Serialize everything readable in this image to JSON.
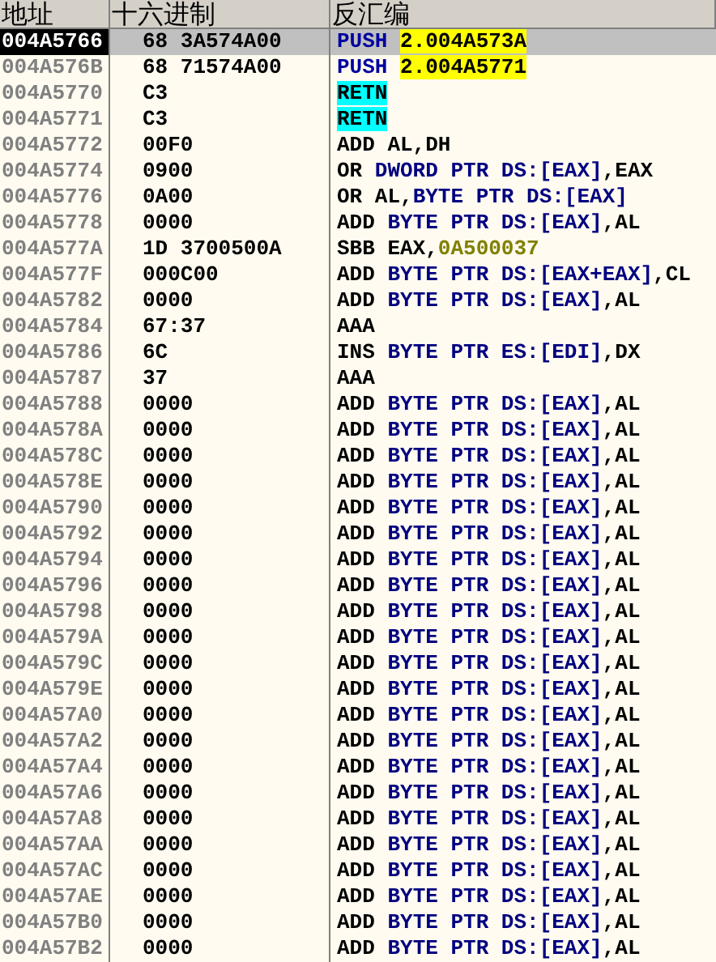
{
  "columns": [
    "地址",
    "十六进制",
    "反汇编"
  ],
  "rows": [
    {
      "address": "004A5766",
      "hex": "68 3A574A00",
      "selected": true,
      "disasm": [
        {
          "text": "PUSH ",
          "kind": "jump"
        },
        {
          "text": "2.004A573A",
          "kind": "target"
        }
      ]
    },
    {
      "address": "004A576B",
      "hex": "68 71574A00",
      "selected": false,
      "disasm": [
        {
          "text": "PUSH ",
          "kind": "jump"
        },
        {
          "text": "2.004A5771",
          "kind": "target"
        }
      ]
    },
    {
      "address": "004A5770",
      "hex": "C3",
      "selected": false,
      "disasm": [
        {
          "text": "RETN",
          "kind": "ret"
        }
      ]
    },
    {
      "address": "004A5771",
      "hex": "C3",
      "selected": false,
      "disasm": [
        {
          "text": "RETN",
          "kind": "ret"
        }
      ]
    },
    {
      "address": "004A5772",
      "hex": "00F0",
      "selected": false,
      "disasm": [
        {
          "text": "ADD AL,DH",
          "kind": "plain"
        }
      ]
    },
    {
      "address": "004A5774",
      "hex": "0900",
      "selected": false,
      "disasm": [
        {
          "text": "OR ",
          "kind": "plain"
        },
        {
          "text": "DWORD PTR DS:[EAX]",
          "kind": "memory"
        },
        {
          "text": ",EAX",
          "kind": "plain"
        }
      ]
    },
    {
      "address": "004A5776",
      "hex": "0A00",
      "selected": false,
      "disasm": [
        {
          "text": "OR AL,",
          "kind": "plain"
        },
        {
          "text": "BYTE PTR DS:[EAX]",
          "kind": "memory"
        }
      ]
    },
    {
      "address": "004A5778",
      "hex": "0000",
      "selected": false,
      "disasm": [
        {
          "text": "ADD ",
          "kind": "plain"
        },
        {
          "text": "BYTE PTR DS:[EAX]",
          "kind": "memory"
        },
        {
          "text": ",AL",
          "kind": "plain"
        }
      ]
    },
    {
      "address": "004A577A",
      "hex": "1D 3700500A",
      "selected": false,
      "disasm": [
        {
          "text": "SBB EAX,",
          "kind": "plain"
        },
        {
          "text": "0A500037",
          "kind": "constant"
        }
      ]
    },
    {
      "address": "004A577F",
      "hex": "000C00",
      "selected": false,
      "disasm": [
        {
          "text": "ADD ",
          "kind": "plain"
        },
        {
          "text": "BYTE PTR DS:[EAX+EAX]",
          "kind": "memory"
        },
        {
          "text": ",CL",
          "kind": "plain"
        }
      ]
    },
    {
      "address": "004A5782",
      "hex": "0000",
      "selected": false,
      "disasm": [
        {
          "text": "ADD ",
          "kind": "plain"
        },
        {
          "text": "BYTE PTR DS:[EAX]",
          "kind": "memory"
        },
        {
          "text": ",AL",
          "kind": "plain"
        }
      ]
    },
    {
      "address": "004A5784",
      "hex": "67:37",
      "selected": false,
      "disasm": [
        {
          "text": "AAA",
          "kind": "plain"
        }
      ]
    },
    {
      "address": "004A5786",
      "hex": "6C",
      "selected": false,
      "disasm": [
        {
          "text": "INS ",
          "kind": "plain"
        },
        {
          "text": "BYTE PTR ES:[EDI]",
          "kind": "memory"
        },
        {
          "text": ",DX",
          "kind": "plain"
        }
      ]
    },
    {
      "address": "004A5787",
      "hex": "37",
      "selected": false,
      "disasm": [
        {
          "text": "AAA",
          "kind": "plain"
        }
      ]
    },
    {
      "address": "004A5788",
      "hex": "0000",
      "selected": false,
      "disasm": [
        {
          "text": "ADD ",
          "kind": "plain"
        },
        {
          "text": "BYTE PTR DS:[EAX]",
          "kind": "memory"
        },
        {
          "text": ",AL",
          "kind": "plain"
        }
      ]
    },
    {
      "address": "004A578A",
      "hex": "0000",
      "selected": false,
      "disasm": [
        {
          "text": "ADD ",
          "kind": "plain"
        },
        {
          "text": "BYTE PTR DS:[EAX]",
          "kind": "memory"
        },
        {
          "text": ",AL",
          "kind": "plain"
        }
      ]
    },
    {
      "address": "004A578C",
      "hex": "0000",
      "selected": false,
      "disasm": [
        {
          "text": "ADD ",
          "kind": "plain"
        },
        {
          "text": "BYTE PTR DS:[EAX]",
          "kind": "memory"
        },
        {
          "text": ",AL",
          "kind": "plain"
        }
      ]
    },
    {
      "address": "004A578E",
      "hex": "0000",
      "selected": false,
      "disasm": [
        {
          "text": "ADD ",
          "kind": "plain"
        },
        {
          "text": "BYTE PTR DS:[EAX]",
          "kind": "memory"
        },
        {
          "text": ",AL",
          "kind": "plain"
        }
      ]
    },
    {
      "address": "004A5790",
      "hex": "0000",
      "selected": false,
      "disasm": [
        {
          "text": "ADD ",
          "kind": "plain"
        },
        {
          "text": "BYTE PTR DS:[EAX]",
          "kind": "memory"
        },
        {
          "text": ",AL",
          "kind": "plain"
        }
      ]
    },
    {
      "address": "004A5792",
      "hex": "0000",
      "selected": false,
      "disasm": [
        {
          "text": "ADD ",
          "kind": "plain"
        },
        {
          "text": "BYTE PTR DS:[EAX]",
          "kind": "memory"
        },
        {
          "text": ",AL",
          "kind": "plain"
        }
      ]
    },
    {
      "address": "004A5794",
      "hex": "0000",
      "selected": false,
      "disasm": [
        {
          "text": "ADD ",
          "kind": "plain"
        },
        {
          "text": "BYTE PTR DS:[EAX]",
          "kind": "memory"
        },
        {
          "text": ",AL",
          "kind": "plain"
        }
      ]
    },
    {
      "address": "004A5796",
      "hex": "0000",
      "selected": false,
      "disasm": [
        {
          "text": "ADD ",
          "kind": "plain"
        },
        {
          "text": "BYTE PTR DS:[EAX]",
          "kind": "memory"
        },
        {
          "text": ",AL",
          "kind": "plain"
        }
      ]
    },
    {
      "address": "004A5798",
      "hex": "0000",
      "selected": false,
      "disasm": [
        {
          "text": "ADD ",
          "kind": "plain"
        },
        {
          "text": "BYTE PTR DS:[EAX]",
          "kind": "memory"
        },
        {
          "text": ",AL",
          "kind": "plain"
        }
      ]
    },
    {
      "address": "004A579A",
      "hex": "0000",
      "selected": false,
      "disasm": [
        {
          "text": "ADD ",
          "kind": "plain"
        },
        {
          "text": "BYTE PTR DS:[EAX]",
          "kind": "memory"
        },
        {
          "text": ",AL",
          "kind": "plain"
        }
      ]
    },
    {
      "address": "004A579C",
      "hex": "0000",
      "selected": false,
      "disasm": [
        {
          "text": "ADD ",
          "kind": "plain"
        },
        {
          "text": "BYTE PTR DS:[EAX]",
          "kind": "memory"
        },
        {
          "text": ",AL",
          "kind": "plain"
        }
      ]
    },
    {
      "address": "004A579E",
      "hex": "0000",
      "selected": false,
      "disasm": [
        {
          "text": "ADD ",
          "kind": "plain"
        },
        {
          "text": "BYTE PTR DS:[EAX]",
          "kind": "memory"
        },
        {
          "text": ",AL",
          "kind": "plain"
        }
      ]
    },
    {
      "address": "004A57A0",
      "hex": "0000",
      "selected": false,
      "disasm": [
        {
          "text": "ADD ",
          "kind": "plain"
        },
        {
          "text": "BYTE PTR DS:[EAX]",
          "kind": "memory"
        },
        {
          "text": ",AL",
          "kind": "plain"
        }
      ]
    },
    {
      "address": "004A57A2",
      "hex": "0000",
      "selected": false,
      "disasm": [
        {
          "text": "ADD ",
          "kind": "plain"
        },
        {
          "text": "BYTE PTR DS:[EAX]",
          "kind": "memory"
        },
        {
          "text": ",AL",
          "kind": "plain"
        }
      ]
    },
    {
      "address": "004A57A4",
      "hex": "0000",
      "selected": false,
      "disasm": [
        {
          "text": "ADD ",
          "kind": "plain"
        },
        {
          "text": "BYTE PTR DS:[EAX]",
          "kind": "memory"
        },
        {
          "text": ",AL",
          "kind": "plain"
        }
      ]
    },
    {
      "address": "004A57A6",
      "hex": "0000",
      "selected": false,
      "disasm": [
        {
          "text": "ADD ",
          "kind": "plain"
        },
        {
          "text": "BYTE PTR DS:[EAX]",
          "kind": "memory"
        },
        {
          "text": ",AL",
          "kind": "plain"
        }
      ]
    },
    {
      "address": "004A57A8",
      "hex": "0000",
      "selected": false,
      "disasm": [
        {
          "text": "ADD ",
          "kind": "plain"
        },
        {
          "text": "BYTE PTR DS:[EAX]",
          "kind": "memory"
        },
        {
          "text": ",AL",
          "kind": "plain"
        }
      ]
    },
    {
      "address": "004A57AA",
      "hex": "0000",
      "selected": false,
      "disasm": [
        {
          "text": "ADD ",
          "kind": "plain"
        },
        {
          "text": "BYTE PTR DS:[EAX]",
          "kind": "memory"
        },
        {
          "text": ",AL",
          "kind": "plain"
        }
      ]
    },
    {
      "address": "004A57AC",
      "hex": "0000",
      "selected": false,
      "disasm": [
        {
          "text": "ADD ",
          "kind": "plain"
        },
        {
          "text": "BYTE PTR DS:[EAX]",
          "kind": "memory"
        },
        {
          "text": ",AL",
          "kind": "plain"
        }
      ]
    },
    {
      "address": "004A57AE",
      "hex": "0000",
      "selected": false,
      "disasm": [
        {
          "text": "ADD ",
          "kind": "plain"
        },
        {
          "text": "BYTE PTR DS:[EAX]",
          "kind": "memory"
        },
        {
          "text": ",AL",
          "kind": "plain"
        }
      ]
    },
    {
      "address": "004A57B0",
      "hex": "0000",
      "selected": false,
      "disasm": [
        {
          "text": "ADD ",
          "kind": "plain"
        },
        {
          "text": "BYTE PTR DS:[EAX]",
          "kind": "memory"
        },
        {
          "text": ",AL",
          "kind": "plain"
        }
      ]
    },
    {
      "address": "004A57B2",
      "hex": "0000",
      "selected": false,
      "disasm": [
        {
          "text": "ADD ",
          "kind": "plain"
        },
        {
          "text": "BYTE PTR DS:[EAX]",
          "kind": "memory"
        },
        {
          "text": ",AL",
          "kind": "plain"
        }
      ]
    }
  ]
}
